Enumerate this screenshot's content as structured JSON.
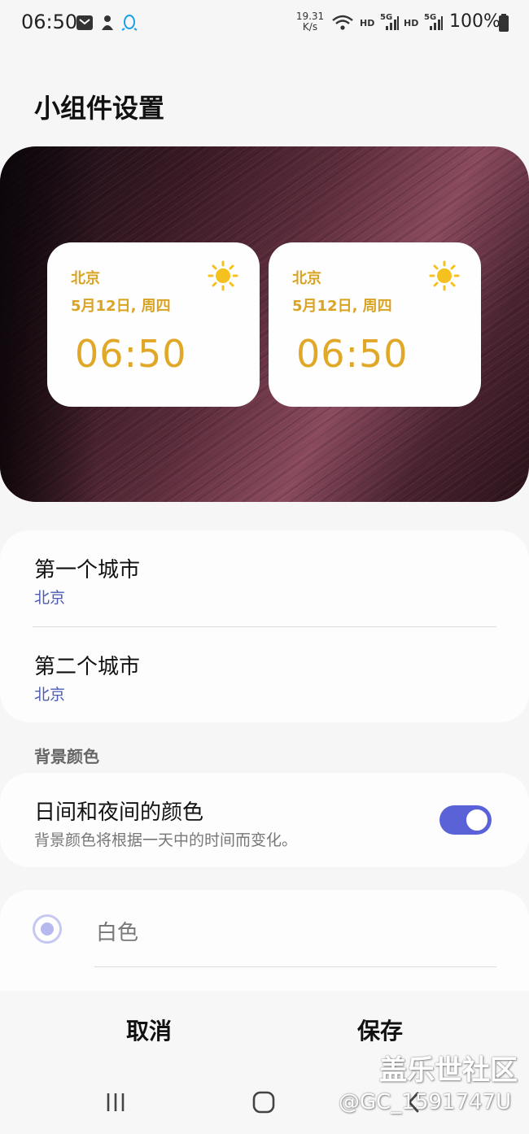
{
  "status_bar": {
    "time": "06:50",
    "net_speed_value": "19.31",
    "net_speed_unit": "K/s",
    "hd_1": "HD",
    "hd_2": "HD",
    "fiveg_1": "5G",
    "fiveg_2": "5G",
    "battery": "100%",
    "icons": [
      "mail-icon",
      "app-notification-icon",
      "qq-icon",
      "wifi-icon",
      "signal-icon",
      "battery-icon"
    ]
  },
  "page": {
    "title": "小组件设置"
  },
  "preview": {
    "widgets": [
      {
        "city": "北京",
        "date": "5月12日, 周四",
        "time": "06:50",
        "icon": "sun-icon"
      },
      {
        "city": "北京",
        "date": "5月12日, 周四",
        "time": "06:50",
        "icon": "sun-icon"
      }
    ]
  },
  "cities": {
    "first": {
      "title": "第一个城市",
      "value": "北京"
    },
    "second": {
      "title": "第二个城市",
      "value": "北京"
    }
  },
  "background": {
    "section_label": "背景颜色",
    "day_night": {
      "title": "日间和夜间的颜色",
      "description": "背景颜色将根据一天中的时间而变化。",
      "enabled": true
    },
    "color_option": {
      "label": "白色",
      "selected": true
    }
  },
  "actions": {
    "cancel": "取消",
    "save": "保存"
  },
  "nav": {
    "icons": [
      "recents-icon",
      "home-icon",
      "back-icon"
    ]
  },
  "watermark": {
    "brand": "盖乐世社区",
    "handle": "@GC_1591747U"
  },
  "colors": {
    "accent": "#5a62d8",
    "widget_text": "#d9a323",
    "link": "#4b5bb5"
  }
}
